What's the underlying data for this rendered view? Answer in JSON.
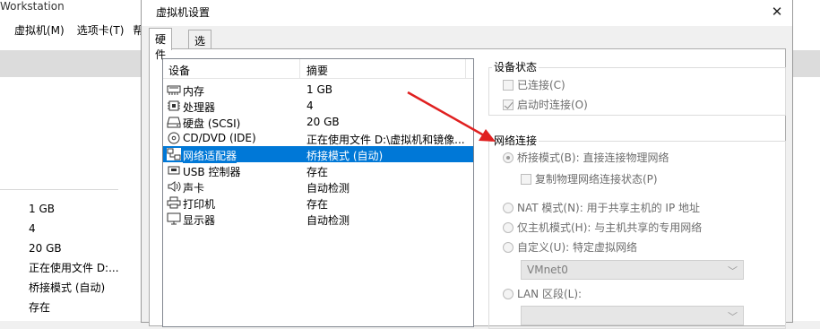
{
  "background_app": {
    "title_fragment": "Workstation",
    "menus": [
      "虚拟机(M)",
      "选项卡(T)",
      "帮"
    ],
    "summary_values": [
      "1 GB",
      "4",
      "20 GB",
      "正在使用文件 D:...",
      "桥接模式 (自动)",
      "存在"
    ]
  },
  "dialog": {
    "title": "虚拟机设置",
    "close_glyph": "✕",
    "tabs": [
      {
        "label": "硬件",
        "active": true
      },
      {
        "label": "选项",
        "active": false
      }
    ],
    "device_list": {
      "col_device": "设备",
      "col_summary": "摘要",
      "rows": [
        {
          "icon": "memory-icon",
          "name": "内存",
          "summary": "1 GB"
        },
        {
          "icon": "processor-icon",
          "name": "处理器",
          "summary": "4"
        },
        {
          "icon": "hard-disk-icon",
          "name": "硬盘 (SCSI)",
          "summary": "20 GB"
        },
        {
          "icon": "cd-dvd-icon",
          "name": "CD/DVD (IDE)",
          "summary": "正在使用文件 D:\\虚拟机和镜像..."
        },
        {
          "icon": "network-adapter-icon",
          "name": "网络适配器",
          "summary": "桥接模式 (自动)",
          "selected": true
        },
        {
          "icon": "usb-icon",
          "name": "USB 控制器",
          "summary": "存在"
        },
        {
          "icon": "sound-card-icon",
          "name": "声卡",
          "summary": "自动检测"
        },
        {
          "icon": "printer-icon",
          "name": "打印机",
          "summary": "存在"
        },
        {
          "icon": "display-icon",
          "name": "显示器",
          "summary": "自动检测"
        }
      ]
    },
    "device_status": {
      "label": "设备状态",
      "connected_label": "已连接(C)",
      "connected_checked": false,
      "connect_at_power_on_label": "启动时连接(O)",
      "connect_at_power_on_checked": true
    },
    "network_connection": {
      "label": "网络连接",
      "bridged_label": "桥接模式(B): 直接连接物理网络",
      "bridged_selected": true,
      "replicate_label": "复制物理网络连接状态(P)",
      "replicate_checked": false,
      "nat_label": "NAT 模式(N): 用于共享主机的 IP 地址",
      "host_only_label": "仅主机模式(H): 与主机共享的专用网络",
      "custom_label": "自定义(U): 特定虚拟网络",
      "custom_value": "VMnet0",
      "lan_segment_label": "LAN 区段(L):",
      "lan_segment_value": ""
    },
    "annotation_arrow_color": "#e02020"
  }
}
